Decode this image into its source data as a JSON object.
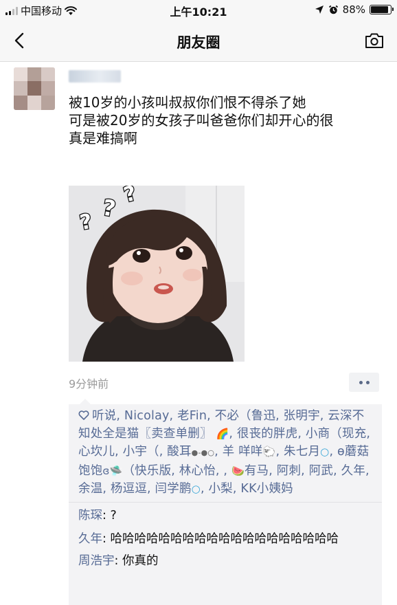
{
  "status_bar": {
    "carrier": "中国移动",
    "time": "上午10:21",
    "battery_text": "88%",
    "battery_level": 0.88,
    "icons": [
      "signal-icon",
      "wifi-icon",
      "location-arrow-icon",
      "alarm-icon",
      "battery-icon"
    ]
  },
  "nav": {
    "title": "朋友圈",
    "back_icon": "chevron-left-icon",
    "camera_icon": "camera-icon"
  },
  "post": {
    "text": "被10岁的小孩叫叔叔你们恨不得杀了她\n可是被20岁的女孩子叫爸爸你们却开心的很\n真是难搞啊",
    "time": "9分钟前"
  },
  "likes": {
    "text": "听说, Nicolay, 老Fin, 不必（鲁迅, 张明宇, 云深不知处全是猫〖卖查单删〗",
    "emoji_rainbow": "🌈",
    "text2": ", 很丧的胖虎, 小商（现充, 心坎儿, 小宇（, 酸耳",
    "emoji_eyes": "●-●○",
    "text3": ", 羊 咩咩",
    "emoji_sheep": "🐑",
    "text4": ", 朱七月",
    "emoji_circle1": "○",
    "text5": ", ɵ蘑菇饱饱",
    "emoji_g": "ɞ",
    "emoji_ufo": "🛸",
    "text6": "（快乐版, 林心怡, ,",
    "emoji_watermelon": "🍉",
    "text7": "有马, 阿刺, 阿武, 久年, 余温, 杨逗逗, 闫学鹏",
    "emoji_circle2": "○",
    "text8": ", 小梨, KK小姨妈"
  },
  "comments": [
    {
      "name": "陈琛",
      "sep": ": ",
      "text": "?"
    },
    {
      "name": "久年",
      "sep": ": ",
      "text": "哈哈哈哈哈哈哈哈哈哈哈哈哈哈哈哈哈哈哈"
    },
    {
      "name": "周浩宇",
      "sep": ": ",
      "text": "你真的"
    }
  ],
  "colors": {
    "link_blue": "#576b95",
    "bar_bg": "#f7f7f7",
    "comment_bg": "#f3f3f5",
    "time_gray": "#9b9b9b"
  }
}
